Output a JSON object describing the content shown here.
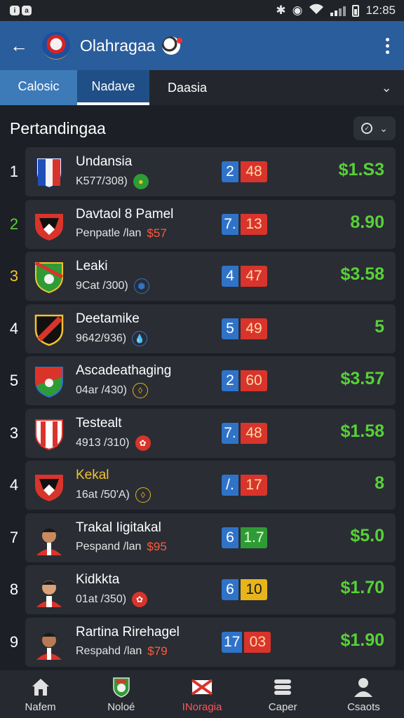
{
  "status_bar": {
    "time": "12:85"
  },
  "app_bar": {
    "title": "Olahragaa"
  },
  "tabs": [
    {
      "label": "Calosic"
    },
    {
      "label": "Nadave"
    },
    {
      "label": "Daasia"
    }
  ],
  "section": {
    "title": "Pertandingaa"
  },
  "rows": [
    {
      "rank": "1",
      "rank_color": "#ffffff",
      "name": "Undansia",
      "name_color": "#ffffff",
      "sub": "K577/308)",
      "sub_price": "",
      "score_a": "2",
      "score_b": "48",
      "score_b_color": "red",
      "value": "$1.S3"
    },
    {
      "rank": "2",
      "rank_color": "#57d137",
      "name": "Davtaol 8 Pamel",
      "name_color": "#ffffff",
      "sub": "Penpatle /lan",
      "sub_price": "$57",
      "score_a": "7.",
      "score_b": "13",
      "score_b_color": "red",
      "value": "8.90"
    },
    {
      "rank": "3",
      "rank_color": "#f2c230",
      "name": "Leaki",
      "name_color": "#ffffff",
      "sub": "9Cat /300)",
      "sub_price": "",
      "score_a": "4",
      "score_b": "47",
      "score_b_color": "red",
      "value": "$3.58"
    },
    {
      "rank": "4",
      "rank_color": "#ffffff",
      "name": "Deetamike",
      "name_color": "#ffffff",
      "sub": "9642/936)",
      "sub_price": "",
      "score_a": "5",
      "score_b": "49",
      "score_b_color": "red",
      "value": "5"
    },
    {
      "rank": "5",
      "rank_color": "#ffffff",
      "name": "Ascadeathaging",
      "name_color": "#ffffff",
      "sub": "04ar /430)",
      "sub_price": "",
      "score_a": "2",
      "score_b": "60",
      "score_b_color": "red",
      "value": "$3.57"
    },
    {
      "rank": "3",
      "rank_color": "#ffffff",
      "name": "Testealt",
      "name_color": "#ffffff",
      "sub": "4913 /310)",
      "sub_price": "",
      "score_a": "7.",
      "score_b": "48",
      "score_b_color": "red",
      "value": "$1.58"
    },
    {
      "rank": "4",
      "rank_color": "#ffffff",
      "name": "Kekal",
      "name_color": "#f2c230",
      "sub": "16at /50'A)",
      "sub_price": "",
      "score_a": "/.",
      "score_b": "17",
      "score_b_color": "red",
      "value": "8"
    },
    {
      "rank": "7",
      "rank_color": "#ffffff",
      "name": "Trakal Iigitakal",
      "name_color": "#ffffff",
      "sub": "Pespand /lan",
      "sub_price": "$95",
      "score_a": "6",
      "score_b": "1.7",
      "score_b_color": "green",
      "value": "$5.0"
    },
    {
      "rank": "8",
      "rank_color": "#ffffff",
      "name": "Kidkkta",
      "name_color": "#ffffff",
      "sub": "01at /350)",
      "sub_price": "",
      "score_a": "6",
      "score_b": "10",
      "score_b_color": "yellow",
      "value": "$1.70"
    },
    {
      "rank": "9",
      "rank_color": "#ffffff",
      "name": "Rartina Rirehagel",
      "name_color": "#ffffff",
      "sub": "Respahd /lan",
      "sub_price": "$79",
      "score_a": "17",
      "score_b": "03",
      "score_b_color": "red",
      "value": "$1.90"
    }
  ],
  "bottom_nav": [
    {
      "label": "Nafem",
      "icon": "home-icon"
    },
    {
      "label": "Noloé",
      "icon": "shield-icon"
    },
    {
      "label": "INoragia",
      "icon": "crossed-flag-icon"
    },
    {
      "label": "Caper",
      "icon": "layers-icon"
    },
    {
      "label": "Csaots",
      "icon": "profile-icon"
    }
  ]
}
